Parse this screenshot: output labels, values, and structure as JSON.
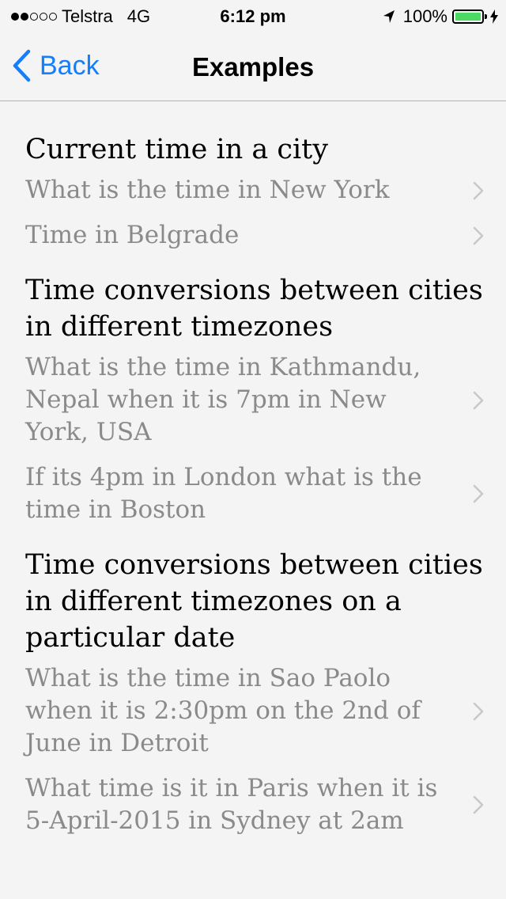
{
  "status_bar": {
    "signal_dots_filled": 2,
    "signal_dots_total": 5,
    "carrier": "Telstra",
    "network": "4G",
    "time": "6:12 pm",
    "battery_percent": "100%",
    "battery_level": 1.0,
    "battery_color": "#4cd964",
    "icons": [
      "location-arrow-icon",
      "battery-icon",
      "charging-bolt-icon"
    ]
  },
  "nav": {
    "back_label": "Back",
    "title": "Examples",
    "accent_color": "#157efb"
  },
  "sections": [
    {
      "heading": "Current time in a city",
      "items": [
        "What is the time in New York",
        "Time in Belgrade"
      ]
    },
    {
      "heading": "Time conversions between cities in different timezones",
      "items": [
        "What is the time in Kathmandu, Nepal when it is 7pm in New York, USA",
        "If its 4pm in London what is the time in Boston"
      ]
    },
    {
      "heading": "Time conversions between cities in different timezones on a particular date",
      "items": [
        "What is the time in Sao Paolo when it is 2:30pm on the 2nd of June in Detroit",
        "What time is it in Paris when it is 5-April-2015 in Sydney at 2am"
      ]
    }
  ]
}
